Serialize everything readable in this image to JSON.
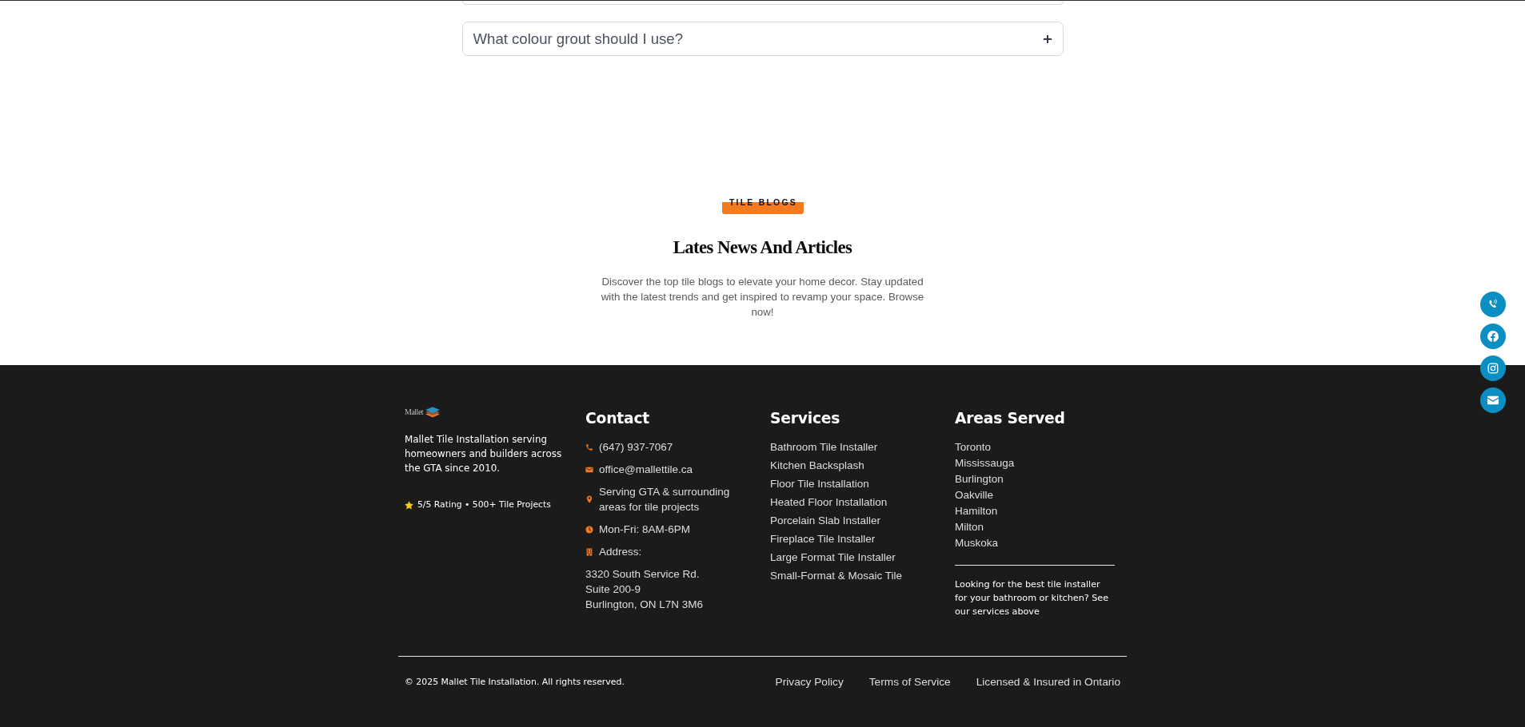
{
  "faq": {
    "items": [
      {
        "kind": "cut_off"
      },
      {
        "kind": "full",
        "question": "What colour grout should I use?",
        "expanded": false
      }
    ]
  },
  "blog_section": {
    "eyebrow": "TILE BLOGS",
    "title": "Lates News And Articles",
    "description": "Discover the top tile blogs to elevate your home decor. Stay updated with the latest trends and get inspired to revamp your space. Browse now!"
  },
  "footer": {
    "brand": {
      "logo_text": "Mallet",
      "about": "Mallet Tile Installation serving homeowners and builders across the GTA since 2010.",
      "rating": "5/5 Rating • 500+ Tile Projects"
    },
    "contact": {
      "heading": "Contact",
      "items": [
        {
          "kind": "phone",
          "text": "(647) 937-7067"
        },
        {
          "kind": "email",
          "text": "office@mallettile.ca"
        },
        {
          "kind": "location",
          "text": "Serving GTA & surrounding areas for tile projects"
        },
        {
          "kind": "hours",
          "text": "Mon-Fri: 8AM-6PM"
        },
        {
          "kind": "address",
          "text": "Address:"
        }
      ],
      "address_lines": [
        "3320 South Service Rd.",
        "Suite 200-9",
        "Burlington, ON L7N 3M6"
      ]
    },
    "services": {
      "heading": "Services",
      "links": [
        "Bathroom Tile Installer",
        "Kitchen Backsplash",
        "Floor Tile Installation",
        "Heated Floor Installation",
        "Porcelain Slab Installer",
        "Fireplace Tile Installer",
        "Large Format Tile Installer",
        "Small-Format & Mosaic Tile"
      ]
    },
    "areas": {
      "heading": "Areas Served",
      "items": [
        "Toronto",
        "Mississauga",
        "Burlington",
        "Oakville",
        "Hamilton",
        "Milton",
        "Muskoka"
      ],
      "note": "Looking for the best tile installer for your bathroom or kitchen? See our services above"
    },
    "bottom_bar": {
      "copyright": "© 2025 Mallet Tile Installation. All rights reserved.",
      "links": [
        "Privacy Policy",
        "Terms of Service",
        "Licensed & Insured in Ontario"
      ]
    }
  },
  "social_buttons": [
    {
      "kind": "phone"
    },
    {
      "kind": "facebook"
    },
    {
      "kind": "instagram"
    },
    {
      "kind": "email"
    }
  ]
}
